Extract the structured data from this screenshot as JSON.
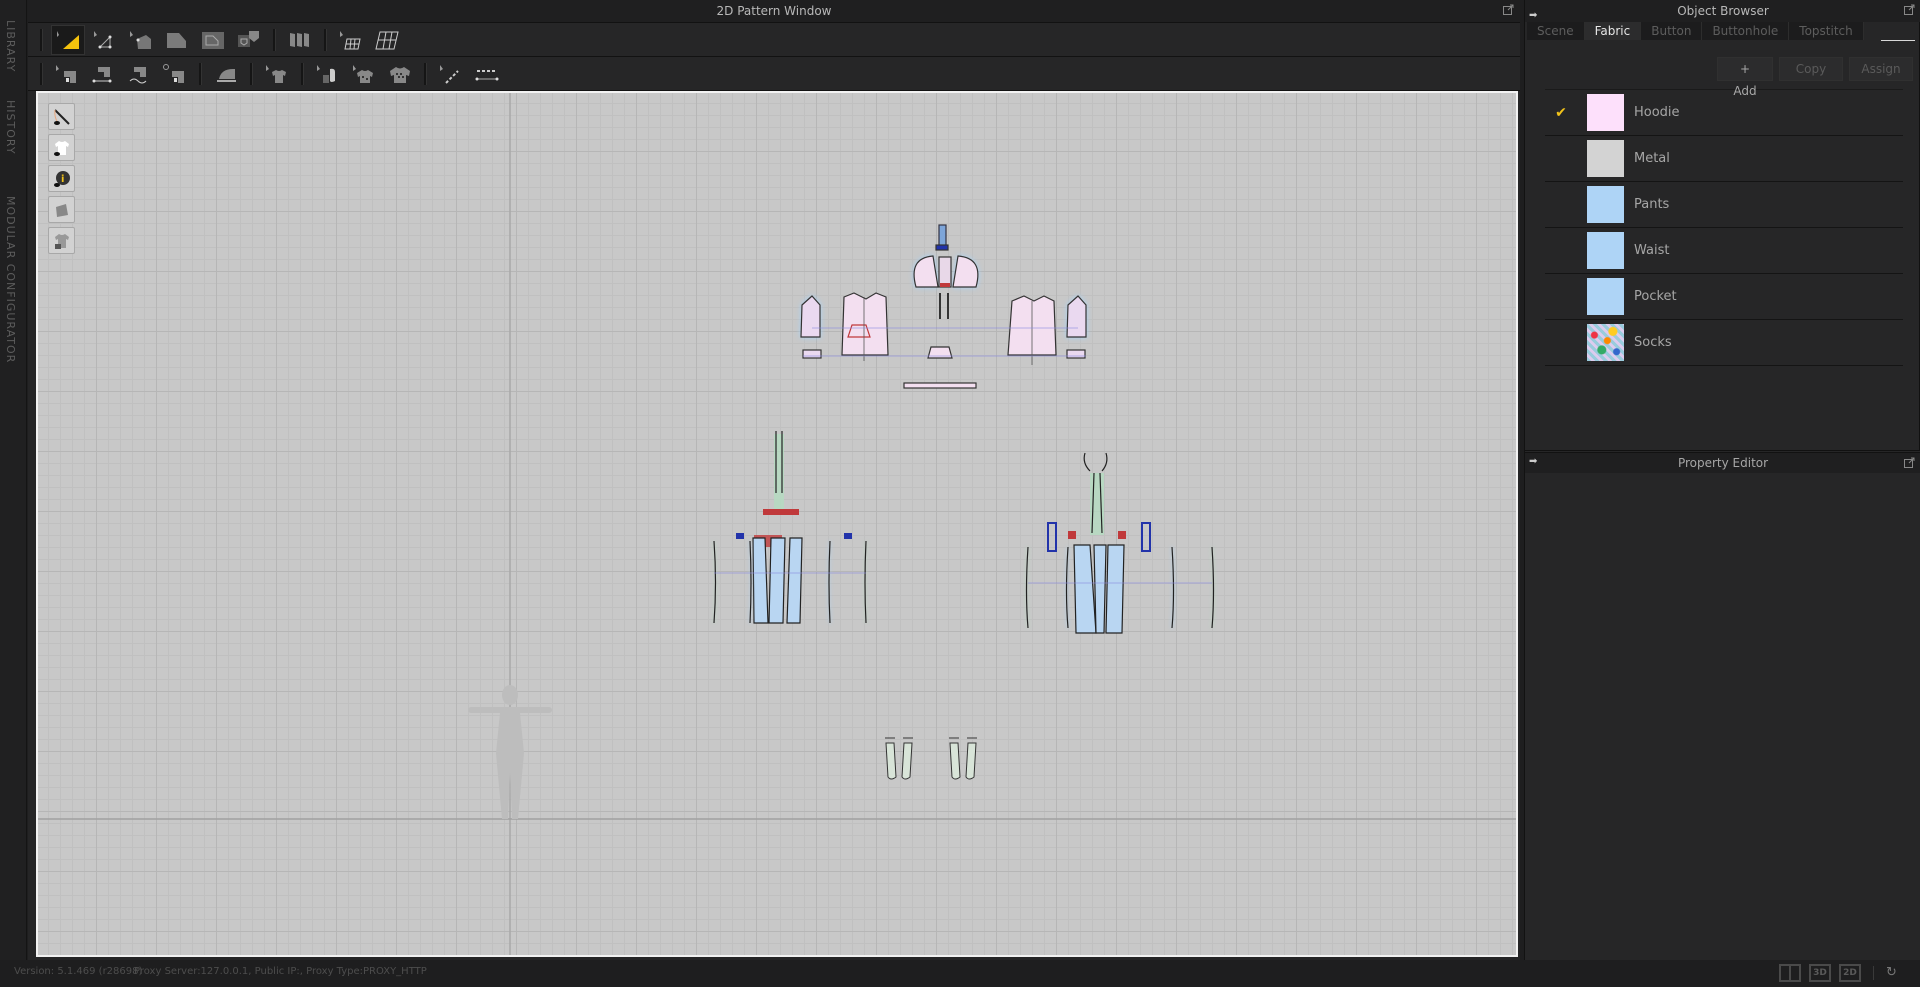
{
  "left_tabs": [
    {
      "label": "LIBRARY"
    },
    {
      "label": "HISTORY"
    },
    {
      "label": "MODULAR CONFIGURATOR"
    }
  ],
  "pattern_window": {
    "title": "2D Pattern Window",
    "toolbar_row1": [
      {
        "icon": "edit-pattern-icon",
        "active": true
      },
      {
        "icon": "edit-curvature-point-icon"
      },
      {
        "icon": "transform-pattern-icon"
      },
      {
        "icon": "polygon-icon"
      },
      {
        "icon": "internal-polygon-icon"
      },
      {
        "icon": "trace-icon"
      },
      {
        "icon": "fold-arrangement-icon"
      },
      {
        "icon": "edit-texture-icon"
      },
      {
        "icon": "transform-texture-icon"
      }
    ],
    "toolbar_row2": [
      {
        "icon": "edit-sewing-icon"
      },
      {
        "icon": "segment-sewing-icon"
      },
      {
        "icon": "free-sewing-icon"
      },
      {
        "icon": "check-sewing-length-icon"
      },
      {
        "icon": "steam-iron-icon"
      },
      {
        "icon": "select-garment-icon"
      },
      {
        "icon": "edit-fabric-icon"
      },
      {
        "icon": "fabric-assign-icon"
      },
      {
        "icon": "fabric-pattern-icon"
      },
      {
        "icon": "edit-topstitch-icon"
      },
      {
        "icon": "segment-topstitch-icon"
      }
    ],
    "side_tools": [
      {
        "icon": "show-sewing-icon"
      },
      {
        "icon": "show-garment-icon"
      },
      {
        "icon": "show-info-icon"
      },
      {
        "icon": "show-pattern-icon"
      },
      {
        "icon": "lock-garment-icon"
      }
    ]
  },
  "object_browser": {
    "title": "Object Browser",
    "tabs": [
      {
        "label": "Scene",
        "active": false
      },
      {
        "label": "Fabric",
        "active": true
      },
      {
        "label": "Button",
        "active": false
      },
      {
        "label": "Buttonhole",
        "active": false
      },
      {
        "label": "Topstitch",
        "active": false
      }
    ],
    "actions": {
      "add": "+ Add",
      "copy": "Copy",
      "assign": "Assign"
    },
    "fabrics": [
      {
        "name": "Hoodie",
        "color": "#fde0fb",
        "selected": true
      },
      {
        "name": "Metal",
        "color": "#d3d3d3",
        "selected": false
      },
      {
        "name": "Pants",
        "color": "#aed4f6",
        "selected": false
      },
      {
        "name": "Waist",
        "color": "#aed4f6",
        "selected": false
      },
      {
        "name": "Pocket",
        "color": "#aed4f6",
        "selected": false
      },
      {
        "name": "Socks",
        "color": "texture",
        "selected": false
      }
    ]
  },
  "property_editor": {
    "title": "Property Editor"
  },
  "status_bar": {
    "version": "Version: 5.1.469 (r28698)",
    "proxy": "Proxy Server:127.0.0.1, Public IP:, Proxy Type:PROXY_HTTP",
    "view_buttons": [
      {
        "icon": "split-view-icon",
        "label": ""
      },
      {
        "icon": "3d-view-icon",
        "label": "3D"
      },
      {
        "icon": "2d-view-icon",
        "label": "2D"
      }
    ],
    "refresh_icon": "refresh-icon"
  },
  "colors": {
    "accent_check": "#f2c31a",
    "hoodie_fill": "#f3dff0",
    "pants_fill": "#b9d6f2",
    "pocket_highlight": "#a8d2f5",
    "waist_green": "#b4dcc0",
    "sewing_red": "#c0393b"
  }
}
